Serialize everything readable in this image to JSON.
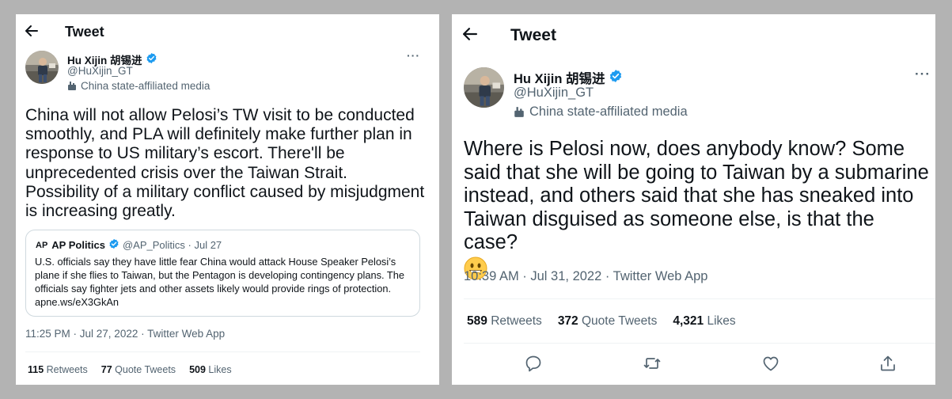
{
  "left_tweet": {
    "header_title": "Tweet",
    "author_name": "Hu Xijin 胡锡进",
    "author_handle": "@HuXijin_GT",
    "affiliation_label": "China state-affiliated media",
    "text": "China will not allow Pelosi’s TW visit to be conducted smoothly, and PLA will definitely make further plan in response to US military’s escort. There'll be unprecedented crisis over the Taiwan Strait. Possibility of a military conflict caused by misjudgment is increasing greatly.",
    "quoted": {
      "logo_text": "AP",
      "name": "AP Politics",
      "handle_date": "@AP_Politics · Jul 27",
      "text": "U.S. officials say they have little fear China would attack House Speaker Pelosi’s plane if she flies to Taiwan, but the Pentagon is developing contingency plans. The officials say fighter jets and other assets likely would provide rings of protection. apne.ws/eX3GkAn"
    },
    "timestamp": "11:25 PM · Jul 27, 2022 · Twitter Web App",
    "stats": {
      "retweets_count": "115",
      "retweets_label": "Retweets",
      "quotes_count": "77",
      "quotes_label": "Quote Tweets",
      "likes_count": "509",
      "likes_label": "Likes"
    }
  },
  "right_tweet": {
    "header_title": "Tweet",
    "author_name": "Hu Xijin 胡锡进",
    "author_handle": "@HuXijin_GT",
    "affiliation_label": "China state-affiliated media",
    "text": "Where is Pelosi now, does anybody know? Some said that she will be going to Taiwan by a submarine instead, and others said that she has sneaked into Taiwan disguised as someone else, is that the case?",
    "emoji": "grinning-face",
    "timestamp": "10:39 AM · Jul 31, 2022 · Twitter Web App",
    "stats": {
      "retweets_count": "589",
      "retweets_label": "Retweets",
      "quotes_count": "372",
      "quotes_label": "Quote Tweets",
      "likes_count": "4,321",
      "likes_label": "Likes"
    },
    "actions": [
      "reply-icon",
      "retweet-icon",
      "like-icon",
      "share-icon"
    ]
  },
  "colors": {
    "background": "#b3b3b3",
    "card": "#ffffff",
    "text": "#0f1419",
    "secondary_text": "#536471",
    "verified_blue": "#1d9bf0",
    "divider": "#eff3f4",
    "quote_border": "#cfd9de"
  }
}
